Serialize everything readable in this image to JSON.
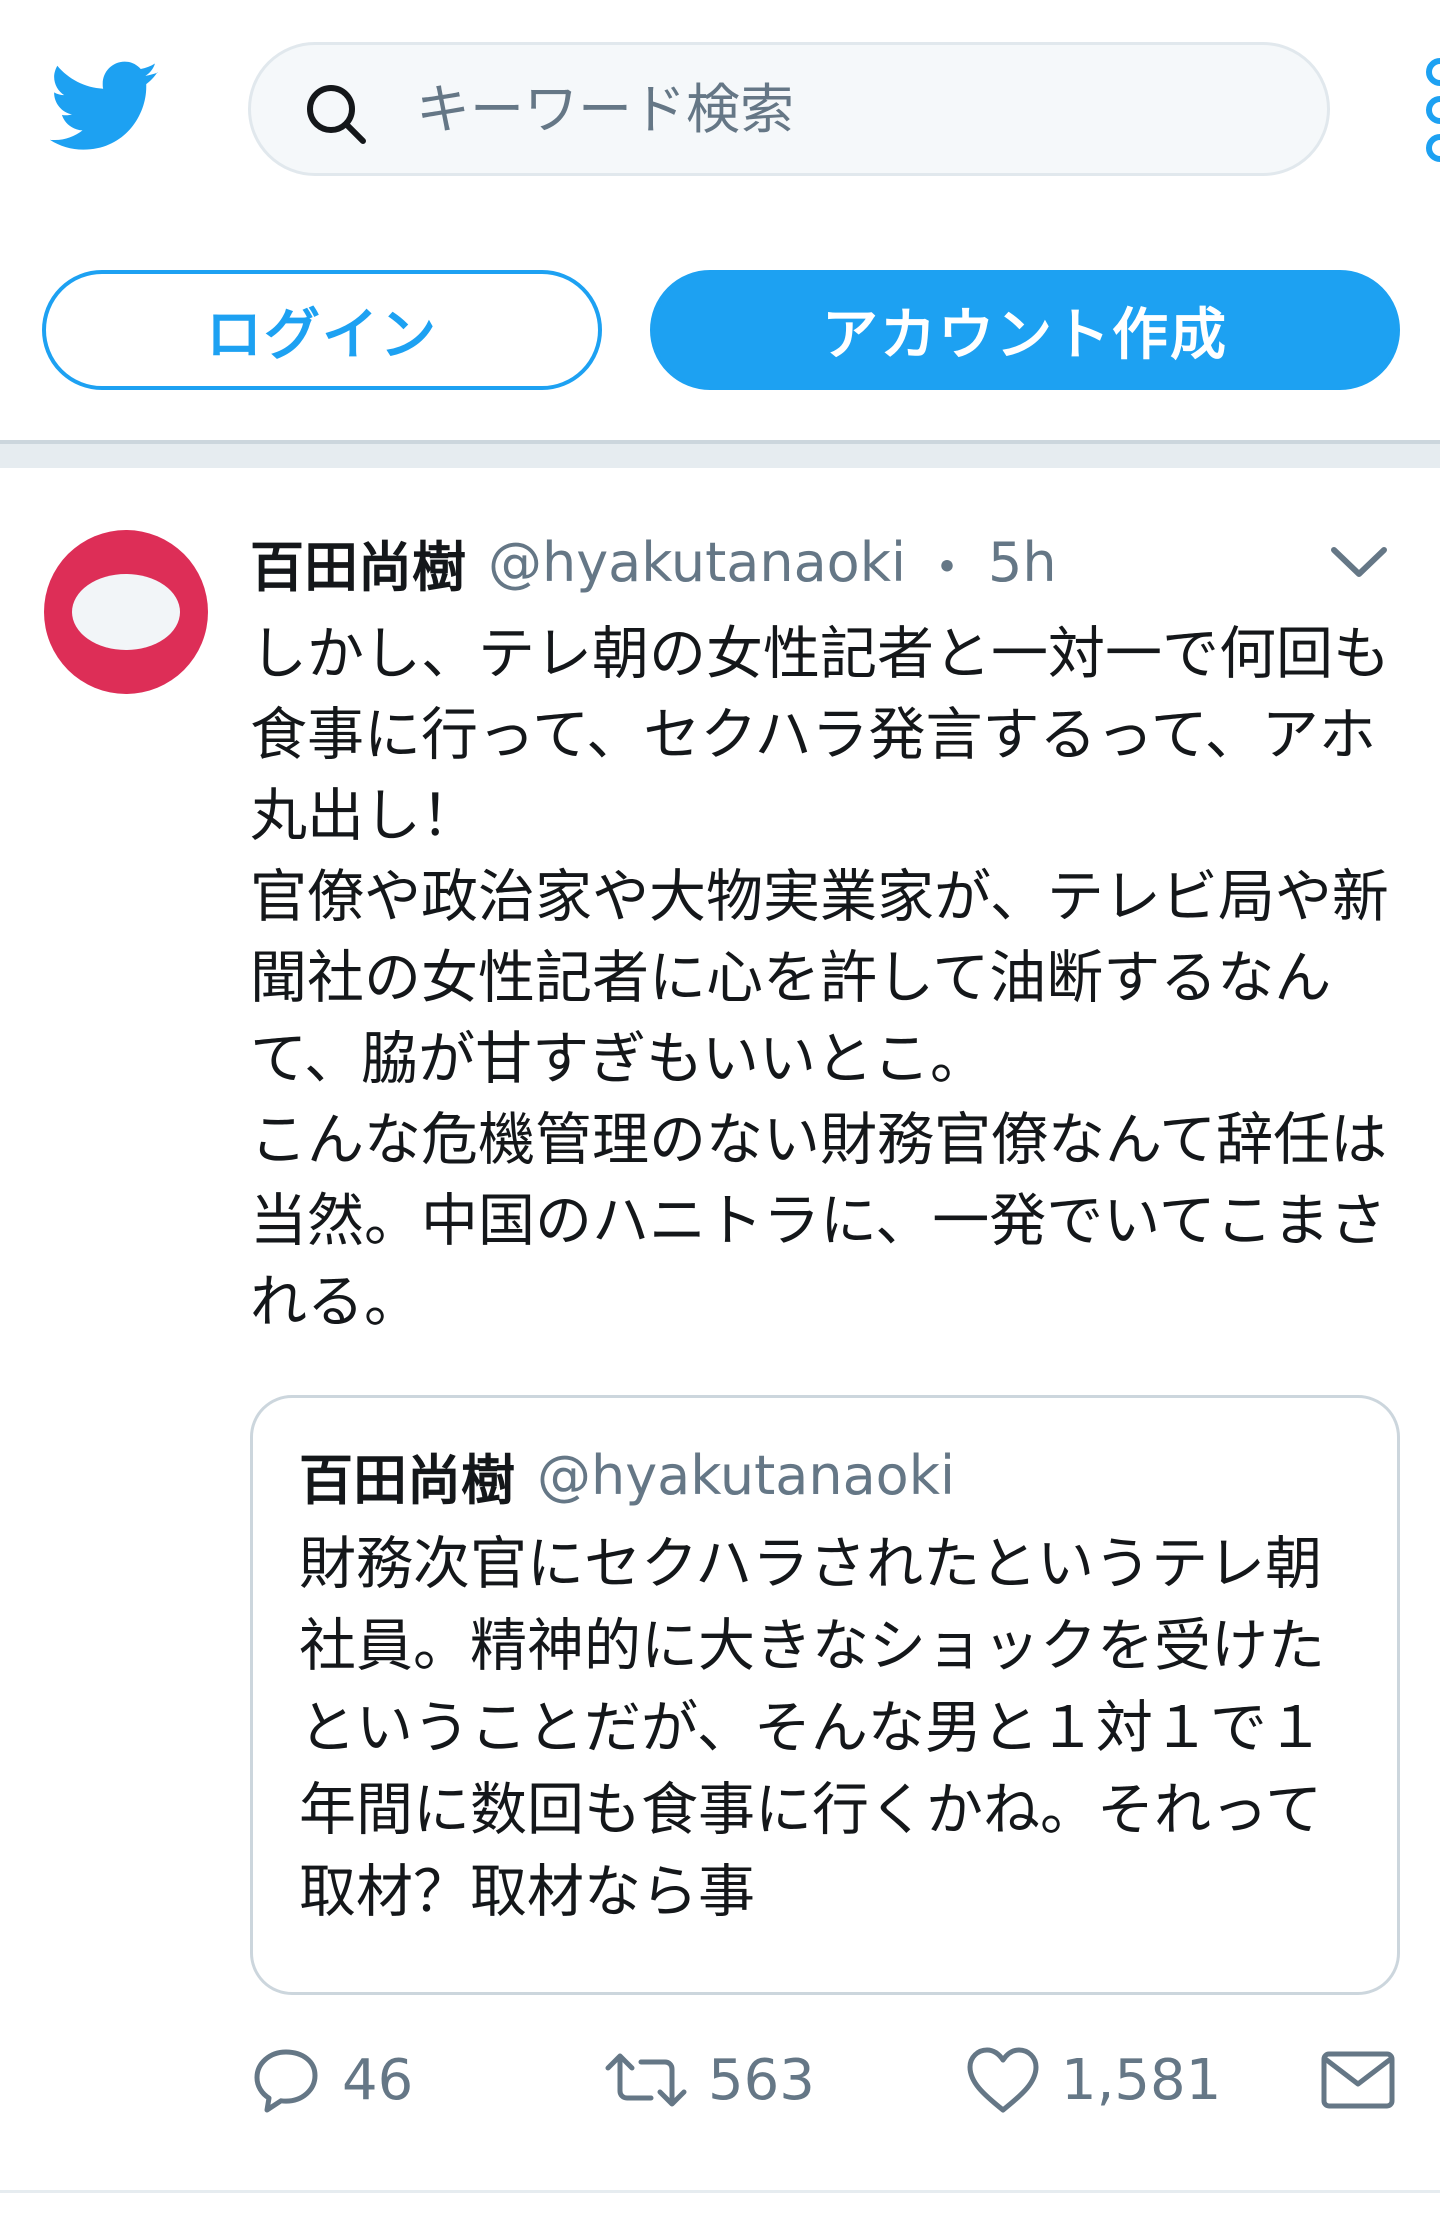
{
  "header": {
    "logo_icon": "twitter-bird-icon",
    "search": {
      "placeholder": "キーワード検索",
      "value": ""
    },
    "menu_icon": "more-dots-icon"
  },
  "auth": {
    "login_label": "ログイン",
    "signup_label": "アカウント作成"
  },
  "tweet": {
    "author_name": "百田尚樹",
    "author_handle": "@hyakutanaoki",
    "separator": "・",
    "time": "5h",
    "text": "しかし、テレ朝の女性記者と一対一で何回も食事に行って、セクハラ発言するって、アホ丸出し！\n官僚や政治家や大物実業家が、テレビ局や新聞社の女性記者に心を許して油断するなんて、脇が甘すぎもいいとこ。\nこんな危機管理のない財務官僚なんて辞任は当然。中国のハニトラに、一発でいてこまされる。",
    "quoted": {
      "author_name": "百田尚樹",
      "author_handle": "@hyakutanaoki",
      "text": "財務次官にセクハラされたというテレ朝社員。精神的に大きなショックを受けたということだが、そんな男と１対１で１年間に数回も食事に行くかね。それって取材？取材なら事"
    },
    "actions": {
      "reply_count": "46",
      "retweet_count": "563",
      "like_count": "1,581"
    }
  },
  "colors": {
    "brand": "#1da1f2",
    "text": "#14171a",
    "secondary": "#657786",
    "avatar": "#dd2e57"
  }
}
